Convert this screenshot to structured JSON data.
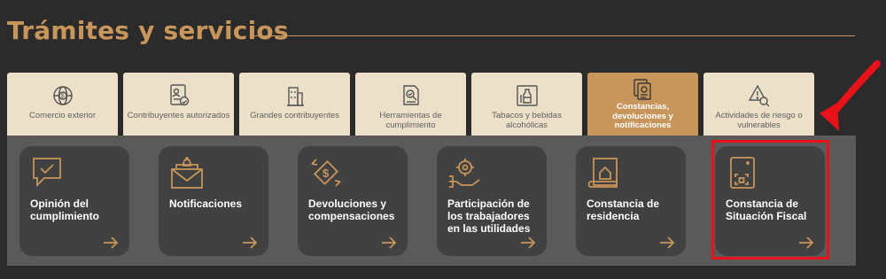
{
  "section": {
    "title": "Trámites y servicios"
  },
  "tabs": [
    {
      "label": "Comercio exterior",
      "icon": "globe-dollar-icon",
      "active": false
    },
    {
      "label": "Contribuyentes autorizados",
      "icon": "id-card-thumbs-icon",
      "active": false
    },
    {
      "label": "Grandes contribuyentes",
      "icon": "buildings-icon",
      "active": false
    },
    {
      "label": "Herramientas de cumplimiento",
      "icon": "document-search-icon",
      "active": false
    },
    {
      "label": "Tabacos y bebidas alcohólicas",
      "icon": "bottle-icon",
      "active": false
    },
    {
      "label": "Constancias, devoluciones y notificaciones",
      "icon": "documents-icon",
      "active": true
    },
    {
      "label": "Actividades de riesgo o vulnerables",
      "icon": "risk-search-icon",
      "active": false
    }
  ],
  "cards": [
    {
      "label": "Opinión del cumplimiento",
      "icon": "speech-check-icon"
    },
    {
      "label": "Notificaciones",
      "icon": "envelope-bell-icon"
    },
    {
      "label": "Devoluciones y compensaciones",
      "icon": "refund-arrows-icon"
    },
    {
      "label": "Participación de los trabajadores en las utilidades",
      "icon": "hand-gear-icon"
    },
    {
      "label": "Constancia de residencia",
      "icon": "scroll-house-icon"
    },
    {
      "label": "Constancia de Situación Fiscal",
      "icon": "qr-document-icon"
    }
  ],
  "colors": {
    "background": "#2b2b2b",
    "accent": "#c8955a",
    "tab_bg": "#ede0c8",
    "panel_bg": "#5a5a5a",
    "card_bg": "#414141",
    "highlight": "#e8121b"
  },
  "annotation": {
    "highlighted_card": "Constancia de Situación Fiscal",
    "arrow": "red-curved-arrow"
  }
}
